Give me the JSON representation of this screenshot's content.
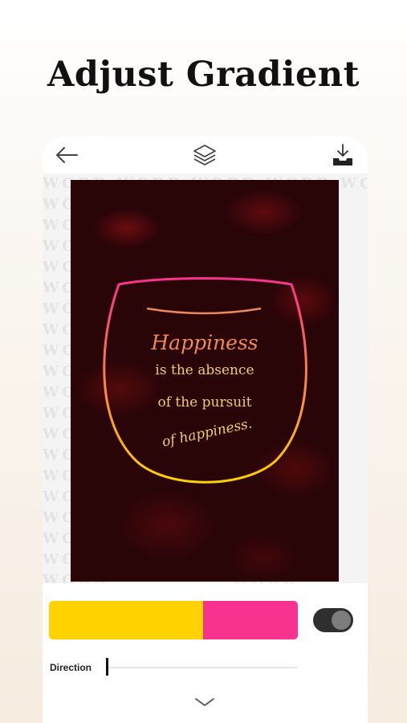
{
  "promo": {
    "title": "Adjust Gradient"
  },
  "toolbar": {
    "back_icon": "arrow-left-icon",
    "layers_icon": "layers-icon",
    "download_icon": "download-tray-icon"
  },
  "canvas": {
    "watermark_text": "WORD",
    "quote": {
      "line1": "Happiness",
      "line2": "is the absence",
      "line3": "of the pursuit",
      "line4": "of happiness."
    }
  },
  "gradient": {
    "color_start": "#FFD200",
    "color_end": "#F7338F",
    "split": 0.62
  },
  "toggle": {
    "state": "on"
  },
  "direction": {
    "label": "Direction",
    "value": 0
  },
  "colors": {
    "quote_title": "#F08A55",
    "quote_body": "#F2CD68",
    "poster_bg": "#2A0508"
  }
}
